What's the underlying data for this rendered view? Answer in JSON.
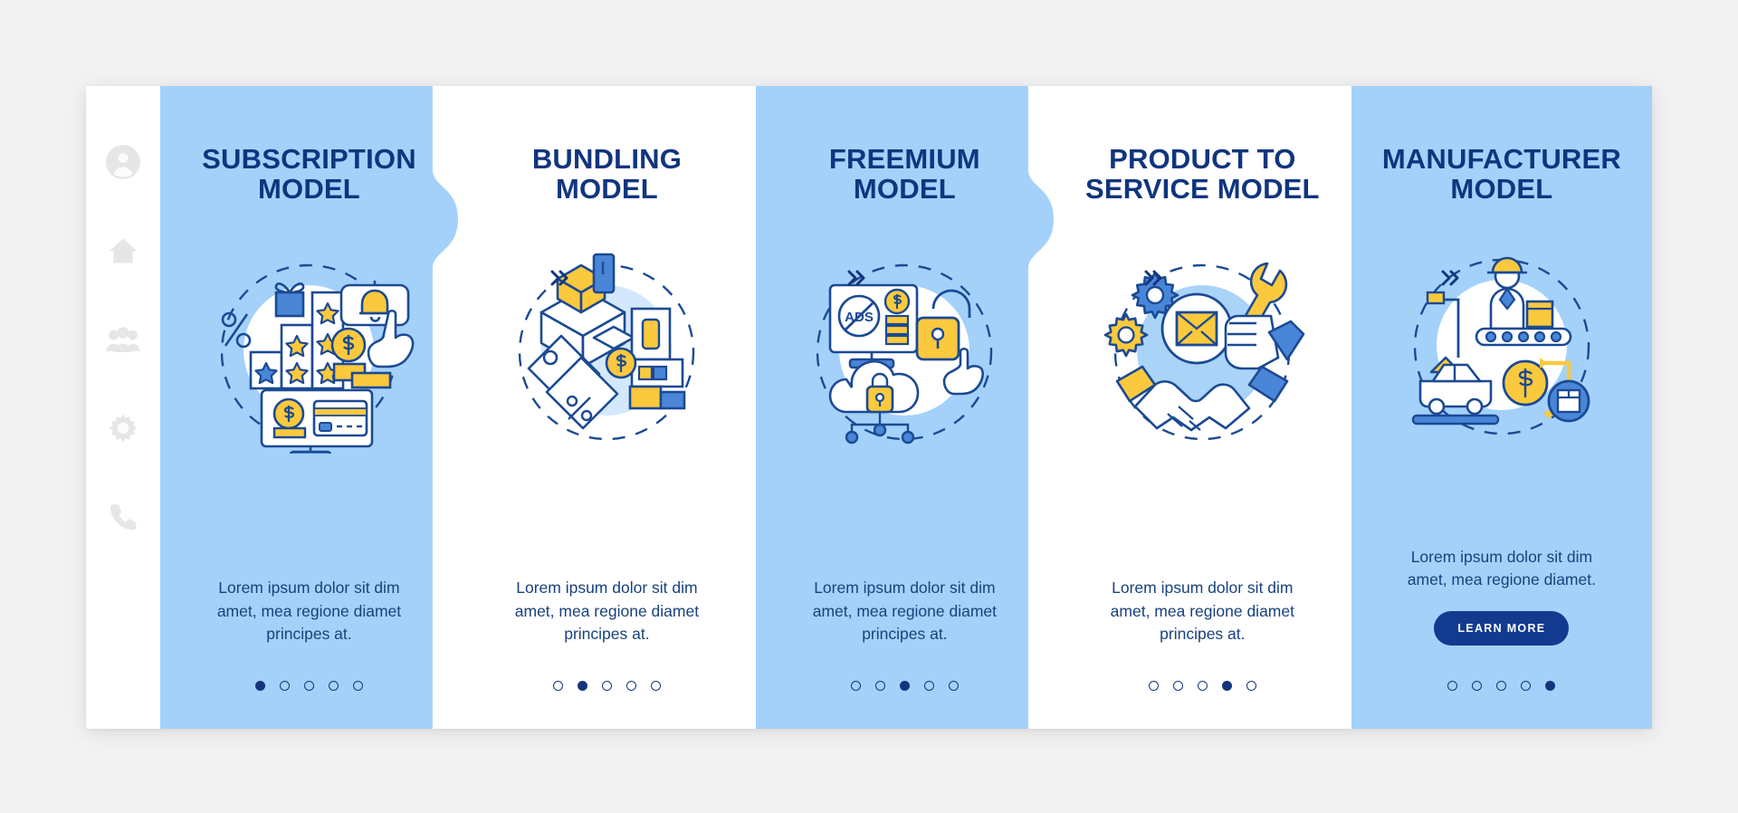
{
  "theme": {
    "page_bg": "#f2f2f2",
    "panel_blue": "#a3d1fa",
    "panel_white": "#ffffff",
    "title_navy": "#10357f",
    "body_navy": "#18427c",
    "accent_yellow": "#fbc93d",
    "accent_blue": "#4a86d8",
    "button_navy": "#123a8f",
    "sidebar_icon_gray": "#e3e3e3"
  },
  "sidebar": {
    "items": [
      {
        "icon": "user-avatar-icon",
        "name": "sidebar-item-profile"
      },
      {
        "icon": "home-icon",
        "name": "sidebar-item-home"
      },
      {
        "icon": "users-group-icon",
        "name": "sidebar-item-team"
      },
      {
        "icon": "gear-icon",
        "name": "sidebar-item-settings"
      },
      {
        "icon": "phone-icon",
        "name": "sidebar-item-contact"
      }
    ]
  },
  "separators": [
    {
      "icon": "double-chevron-right-icon",
      "glyph": "»"
    },
    {
      "icon": "double-chevron-right-icon",
      "glyph": "»"
    },
    {
      "icon": "double-chevron-right-icon",
      "glyph": "»"
    },
    {
      "icon": "double-chevron-right-icon",
      "glyph": "»"
    }
  ],
  "panels": [
    {
      "title": "SUBSCRIPTION MODEL",
      "body": "Lorem ipsum dolor sit dim amet, mea regione diamet principes at.",
      "illustration": "subscription-illustration",
      "background": "blue",
      "dots_total": 5,
      "dots_active_index": 0,
      "button": null
    },
    {
      "title": "BUNDLING MODEL",
      "body": "Lorem ipsum dolor sit dim amet, mea regione diamet principes at.",
      "illustration": "bundling-illustration",
      "background": "white",
      "dots_total": 5,
      "dots_active_index": 1,
      "button": null
    },
    {
      "title": "FREEMIUM MODEL",
      "body": "Lorem ipsum dolor sit dim amet, mea regione diamet principes at.",
      "illustration": "freemium-illustration",
      "background": "blue",
      "dots_total": 5,
      "dots_active_index": 2,
      "button": null
    },
    {
      "title": "PRODUCT TO SERVICE MODEL",
      "body": "Lorem ipsum dolor sit dim amet, mea regione diamet principes at.",
      "illustration": "product-to-service-illustration",
      "background": "white",
      "dots_total": 5,
      "dots_active_index": 3,
      "button": null
    },
    {
      "title": "MANUFACTURER MODEL",
      "body": "Lorem ipsum dolor sit dim amet, mea regione diamet.",
      "illustration": "manufacturer-illustration",
      "background": "blue",
      "dots_total": 5,
      "dots_active_index": 4,
      "button": "LEARN MORE"
    }
  ]
}
